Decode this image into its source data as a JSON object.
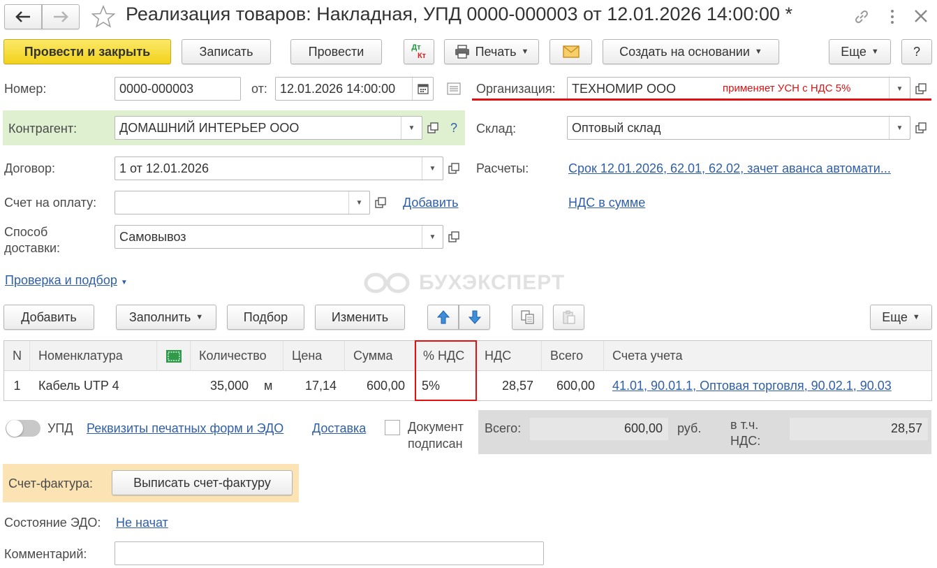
{
  "window": {
    "title": "Реализация товаров: Накладная, УПД 0000-000003 от 12.01.2026 14:00:00 *",
    "back_icon": "arrow-left-icon",
    "forward_icon": "arrow-right-icon",
    "favorite_icon": "star-icon",
    "link_icon": "link-icon",
    "more_icon": "vertical-dots-icon",
    "close_icon": "close-icon"
  },
  "toolbar": {
    "post_close": "Провести и закрыть",
    "save": "Записать",
    "post": "Провести",
    "dtkt_top": "Дт",
    "dtkt_bottom": "Кт",
    "print": "Печать",
    "create_based": "Создать на основании",
    "more": "Еще",
    "help": "?"
  },
  "form": {
    "number_label": "Номер:",
    "number_value": "0000-000003",
    "date_label": "от:",
    "date_value": "12.01.2026 14:00:00",
    "org_label": "Организация:",
    "org_value": "ТЕХНОМИР ООО",
    "org_note": "применяет УСН с НДС 5%",
    "contractor_label": "Контрагент:",
    "contractor_value": "ДОМАШНИЙ ИНТЕРЬЕР ООО",
    "contractor_help": "?",
    "warehouse_label": "Склад:",
    "warehouse_value": "Оптовый склад",
    "contract_label": "Договор:",
    "contract_value": "1 от 12.01.2026",
    "payments_label": "Расчеты:",
    "payments_link": "Срок 12.01.2026, 62.01, 62.02, зачет аванса автомати...",
    "invoice_label": "Счет на оплату:",
    "invoice_value": "",
    "add_link": "Добавить",
    "vat_link": "НДС в сумме",
    "delivery_label_1": "Способ",
    "delivery_label_2": "доставки:",
    "delivery_value": "Самовывоз",
    "check_link": "Проверка и подбор",
    "watermark": "БУХЭКСПЕРТ"
  },
  "table_toolbar": {
    "add": "Добавить",
    "fill": "Заполнить",
    "pick": "Подбор",
    "change": "Изменить",
    "more": "Еще"
  },
  "table": {
    "headers": [
      "N",
      "Номенклатура",
      "",
      "Количество",
      "Цена",
      "Сумма",
      "% НДС",
      "НДС",
      "Всего",
      "Счета учета"
    ],
    "rows": [
      {
        "n": "1",
        "item": "Кабель UTP 4",
        "qty": "35,000",
        "unit": "м",
        "price": "17,14",
        "sum": "600,00",
        "vat_rate": "5%",
        "vat": "28,57",
        "total": "600,00",
        "accounts": "41.01, 90.01.1, Оптовая торговля, 90.02.1, 90.03"
      }
    ]
  },
  "bottom": {
    "upd_label": "УПД",
    "requisites_link": "Реквизиты печатных форм и ЭДО",
    "delivery_link": "Доставка",
    "signed_1": "Документ",
    "signed_2": "подписан",
    "total_label": "Всего:",
    "total_value": "600,00",
    "currency": "руб.",
    "incl_vat_1": "в т.ч.",
    "incl_vat_2": "НДС:",
    "vat_value": "28,57",
    "invoice_doc_label": "Счет-фактура:",
    "issue_invoice_button": "Выписать счет-фактуру",
    "edo_label": "Состояние ЭДО:",
    "edo_link": "Не начат",
    "comment_label": "Комментарий:",
    "comment_value": ""
  },
  "colors": {
    "highlight_red": "#e01010",
    "link_blue": "#2f5fa8",
    "contractor_bg": "#dff0d0",
    "invoice_bg": "#fbe3b4",
    "primary_yellow": "#f5d92a"
  }
}
